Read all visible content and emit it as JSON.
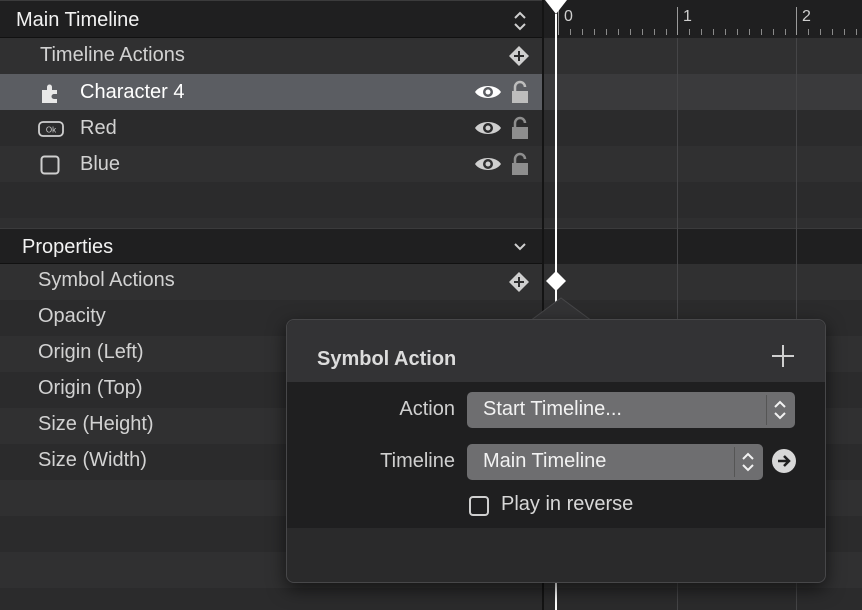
{
  "main_timeline": {
    "title": "Main Timeline",
    "timeline_actions_label": "Timeline Actions",
    "layers": [
      {
        "name": "Character 4",
        "icon": "puzzle-icon",
        "selected": true
      },
      {
        "name": "Red",
        "icon": "button-ok-icon",
        "selected": false
      },
      {
        "name": "Blue",
        "icon": "rectangle-icon",
        "selected": false
      }
    ]
  },
  "ruler": {
    "marks": [
      "0",
      "1",
      "2"
    ]
  },
  "properties": {
    "title": "Properties",
    "items": [
      "Symbol Actions",
      "Opacity",
      "Origin (Left)",
      "Origin (Top)",
      "Size (Height)",
      "Size (Width)"
    ]
  },
  "popover": {
    "title": "Symbol Action",
    "action_label": "Action",
    "action_value": "Start Timeline...",
    "timeline_label": "Timeline",
    "timeline_value": "Main Timeline",
    "reverse_label": "Play in reverse",
    "reverse_checked": false
  },
  "colors": {
    "selected_row": "#5b5d62",
    "header": "#1f1f20",
    "playhead": "#ffffff"
  }
}
